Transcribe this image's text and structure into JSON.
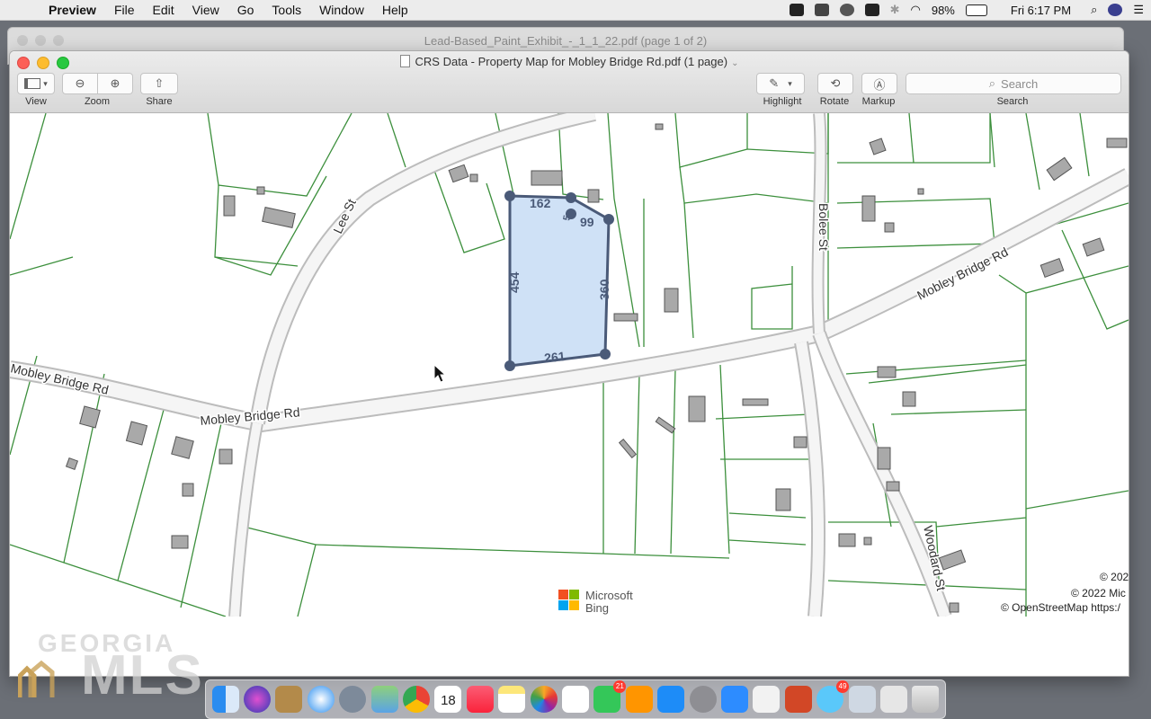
{
  "menubar": {
    "app": "Preview",
    "items": [
      "File",
      "Edit",
      "View",
      "Go",
      "Tools",
      "Window",
      "Help"
    ],
    "battery": "98%",
    "clock": "Fri 6:17 PM"
  },
  "back_window": {
    "title": "Lead-Based_Paint_Exhibit_-_1_1_22.pdf (page 1 of 2)"
  },
  "window": {
    "title": "CRS Data - Property Map for Mobley Bridge Rd.pdf (1 page)"
  },
  "toolbar": {
    "view_label": "View",
    "zoom_label": "Zoom",
    "share_label": "Share",
    "highlight_label": "Highlight",
    "rotate_label": "Rotate",
    "markup_label": "Markup",
    "search_label": "Search",
    "search_placeholder": "Search"
  },
  "map": {
    "streets": [
      "Mobley Bridge Rd",
      "Mobley Bridge Rd",
      "Mobley Bridge Rd",
      "Lee St",
      "Bolee St",
      "Woodard St"
    ],
    "dimensions": [
      "162",
      "99",
      "454",
      "360",
      "261",
      "5"
    ],
    "attribution": [
      "© 202",
      "© 2022 Mic",
      "© OpenStreetMap https:/"
    ],
    "provider": [
      "Microsoft",
      "Bing"
    ],
    "colors": {
      "parcel_line": "#2e8b2e",
      "parcel_fill": "#cfe1f6",
      "parcel_stroke": "#4a5a78",
      "building": "#a9a9a9"
    }
  },
  "watermark": {
    "line1": "GEORGIA",
    "line2": "MLS"
  },
  "dock": {
    "calendar_day": "18",
    "badge": "21",
    "badge2": "49"
  }
}
